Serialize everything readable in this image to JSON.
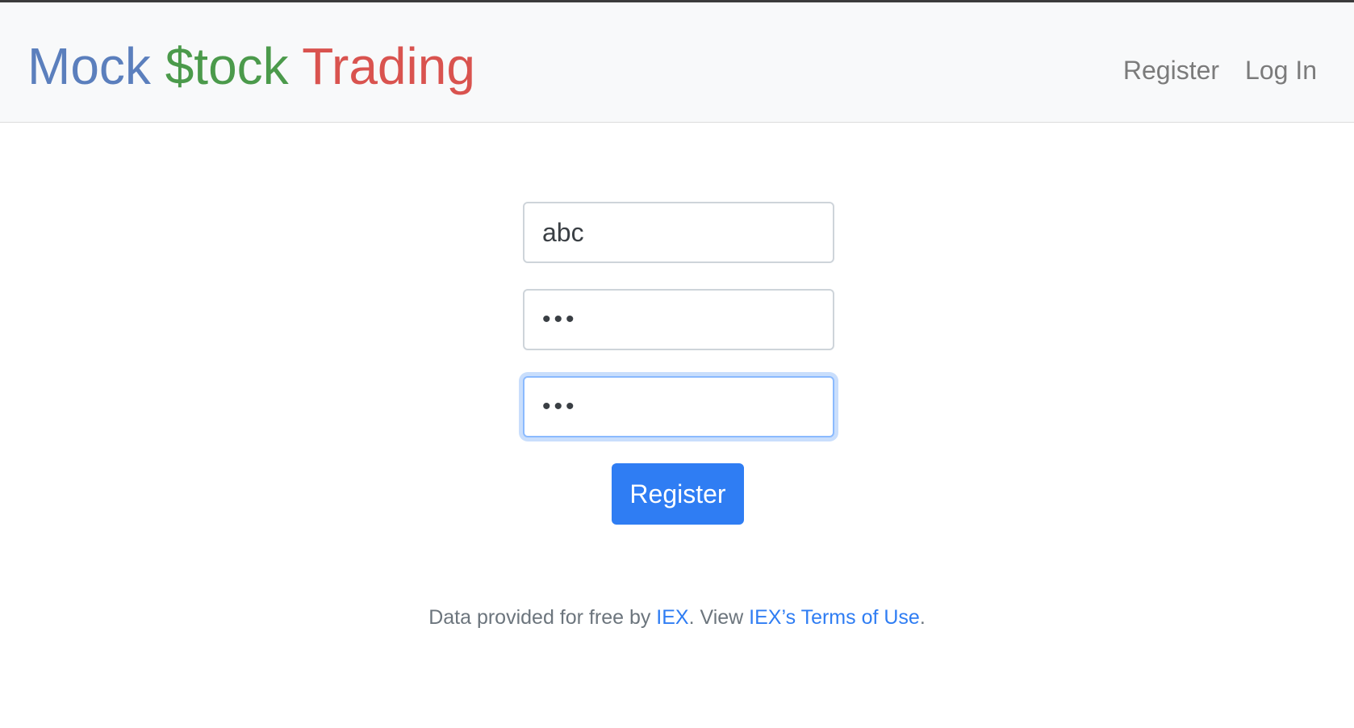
{
  "navbar": {
    "brand": {
      "word1": "Mock",
      "word2": "$tock",
      "word3": "Trading",
      "color1": "#5b7fbd",
      "color2": "#4b9a4b",
      "color3": "#d9534f"
    },
    "links": {
      "register": "Register",
      "login": "Log In"
    }
  },
  "form": {
    "username_value": "abc",
    "password_value": "•••",
    "confirmation_value": "•••",
    "submit_label": "Register"
  },
  "footer": {
    "text_before": "Data provided for free by ",
    "iex_link": "IEX",
    "text_middle": ". View ",
    "terms_link": "IEX’s Terms of Use",
    "text_after": "."
  },
  "colors": {
    "primary": "#2f7df3",
    "navbar_bg": "#f8f9fa",
    "muted_text": "#6c757d"
  }
}
